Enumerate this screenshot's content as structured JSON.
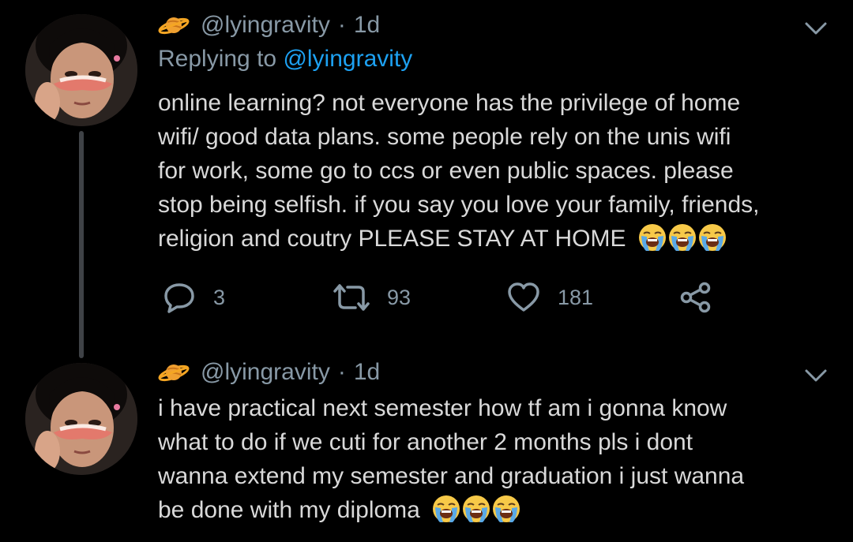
{
  "tweets": [
    {
      "handle": "@lyingravity",
      "separator": "·",
      "time": "1d",
      "replying_label": "Replying to ",
      "replying_handle": "@lyingravity",
      "text": "online learning? not everyone has the privilege of home\nwifi/ good data plans. some people rely on the unis wifi\nfor work, some go to ccs or even public spaces. please\nstop being selfish. if you say you love your family, friends,\nreligion and coutry PLEASE STAY AT HOME",
      "emoji": [
        "loudly-crying-face",
        "loudly-crying-face",
        "loudly-crying-face"
      ],
      "actions": {
        "replies": "3",
        "retweets": "93",
        "likes": "181"
      }
    },
    {
      "handle": "@lyingravity",
      "separator": "·",
      "time": "1d",
      "text": "i have practical next semester how tf am i gonna know\nwhat to do if we cuti for another 2 months pls i dont\nwanna extend my semester and graduation i just wanna\nbe done with my diploma",
      "emoji": [
        "loudly-crying-face",
        "loudly-crying-face",
        "loudly-crying-face"
      ]
    }
  ],
  "colors": {
    "background": "#000000",
    "text": "#d9d9d9",
    "muted": "#8899a6",
    "accent": "#1da1f2",
    "thread_line": "#3f4246"
  }
}
